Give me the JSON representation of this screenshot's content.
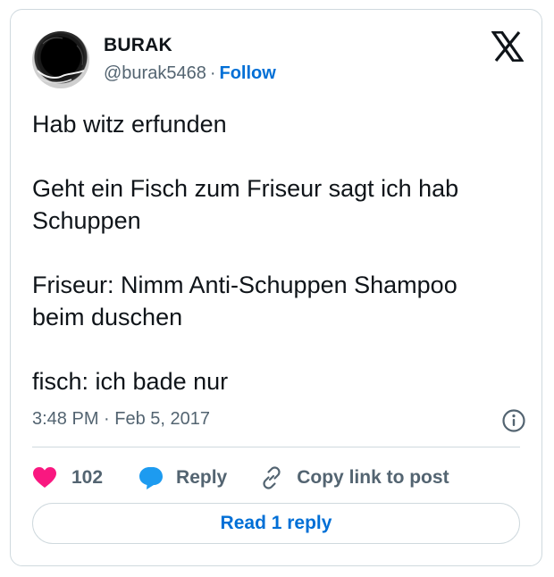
{
  "author": {
    "name": "BURAK",
    "handle": "@burak5468",
    "separator": "·",
    "follow_label": "Follow"
  },
  "tweet": {
    "paragraphs": [
      [
        "Hab witz erfunden"
      ],
      [
        "Geht ein Fisch zum Friseur sagt ich hab",
        "Schuppen"
      ],
      [
        "Friseur: Nimm Anti-Schuppen Shampoo",
        "beim duschen"
      ],
      [
        "fisch: ich bade nur"
      ]
    ],
    "timestamp": "3:48 PM · Feb 5, 2017"
  },
  "actions": {
    "like_count": "102",
    "reply_label": "Reply",
    "copy_label": "Copy link to post"
  },
  "read_reply_label": "Read 1 reply",
  "colors": {
    "accent": "#006fd6",
    "like": "#f91880",
    "reply_icon": "#1d9bf0",
    "secondary_text": "#536471",
    "border": "#cfd9de"
  },
  "icons": {
    "platform": "x-logo-icon",
    "like": "heart-icon",
    "reply": "speech-bubble-icon",
    "copy": "link-icon",
    "info": "info-icon"
  }
}
